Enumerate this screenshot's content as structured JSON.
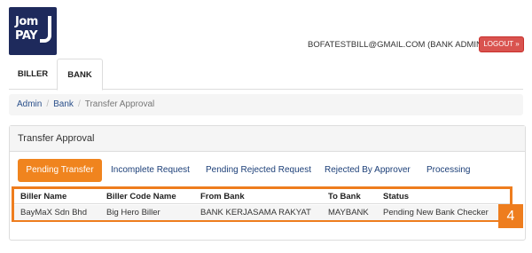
{
  "logo": {
    "line1": "Jom",
    "line2": "PAY"
  },
  "header": {
    "user_email": "BOFATESTBILL@GMAIL.COM (BANK ADMIN)",
    "logout_label": "LOGOUT »"
  },
  "tabs": [
    {
      "label": "BILLER"
    },
    {
      "label": "BANK",
      "active": true
    }
  ],
  "breadcrumb": [
    {
      "label": "Admin"
    },
    {
      "label": "Bank"
    },
    {
      "label": "Transfer Approval"
    }
  ],
  "panel": {
    "title": "Transfer Approval",
    "subtabs": [
      {
        "label": "Pending Transfer",
        "active": true
      },
      {
        "label": "Incomplete Request"
      },
      {
        "label": "Pending Rejected Request"
      },
      {
        "label": "Rejected By Approver"
      },
      {
        "label": "Processing"
      }
    ],
    "table": {
      "headers": [
        "Biller Name",
        "Biller Code Name",
        "From Bank",
        "To Bank",
        "Status"
      ],
      "rows": [
        [
          "BayMaX Sdn Bhd",
          "Big Hero Biller",
          "BANK KERJASAMA RAKYAT",
          "MAYBANK",
          "Pending New Bank Checker"
        ]
      ]
    }
  },
  "step_badge": "4",
  "colors": {
    "accent": "#ee7d1e",
    "logout": "#d9534f",
    "logo_bg": "#1e2a5c",
    "link": "#1c3f78"
  }
}
